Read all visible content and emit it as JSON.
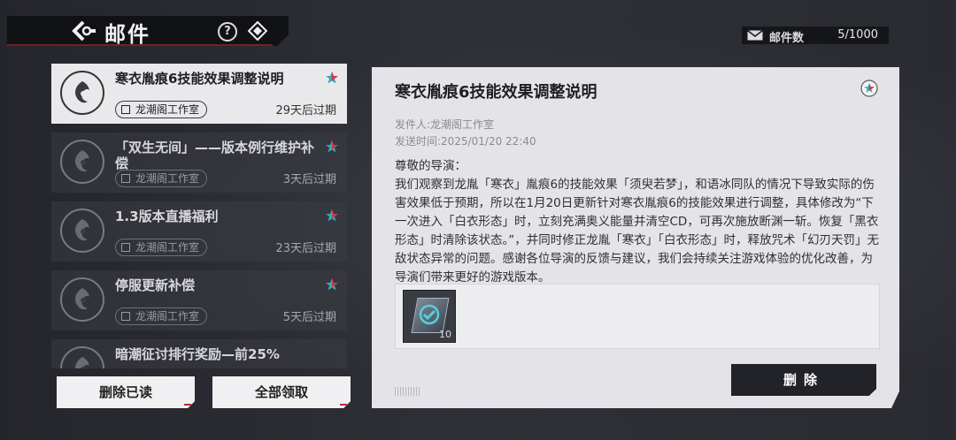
{
  "header": {
    "title": "邮件"
  },
  "mail_count": {
    "label": "邮件数",
    "value": "5/1000"
  },
  "mails": [
    {
      "title": "寒衣胤痕6技能效果调整说明",
      "sender": "龙潮阁工作室",
      "expire": "29天后过期"
    },
    {
      "title": "「双生无间」——版本例行维护补偿",
      "sender": "龙潮阁工作室",
      "expire": "3天后过期"
    },
    {
      "title": "1.3版本直播福利",
      "sender": "龙潮阁工作室",
      "expire": "23天后过期"
    },
    {
      "title": "停服更新补偿",
      "sender": "龙潮阁工作室",
      "expire": "5天后过期"
    },
    {
      "title": "暗潮征讨排行奖励—前25%"
    }
  ],
  "buttons": {
    "delete_read": "删除已读",
    "claim_all": "全部领取",
    "delete": "删除"
  },
  "detail": {
    "title": "寒衣胤痕6技能效果调整说明",
    "sender": "发件人:龙潮阁工作室",
    "time": "发送时间:2025/01/20 22:40",
    "body": "尊敬的导演：\n我们观察到龙胤「寒衣」胤痕6的技能效果「须臾若梦」，和语冰同队的情况下导致实际的伤害效果低于预期，所以在1月20日更新针对寒衣胤痕6的技能效果进行调整，具体修改为“下一次进入「白衣形态」时，立刻充满奥义能量并清空CD，可再次施放断渊一斩。恢复「黑衣形态」时清除该状态。”，并同时修正龙胤「寒衣」「白衣形态」时，释放咒术「幻刃天罚」无敌状态异常的问题。感谢各位导演的反馈与建议，我们会持续关注游戏体验的优化改善，为导演们带来更好的游戏版本。",
    "attachment": {
      "quantity": "10"
    }
  },
  "colors": {
    "accent_red": "#b52c35",
    "star_teal": "#3aa7b0"
  }
}
